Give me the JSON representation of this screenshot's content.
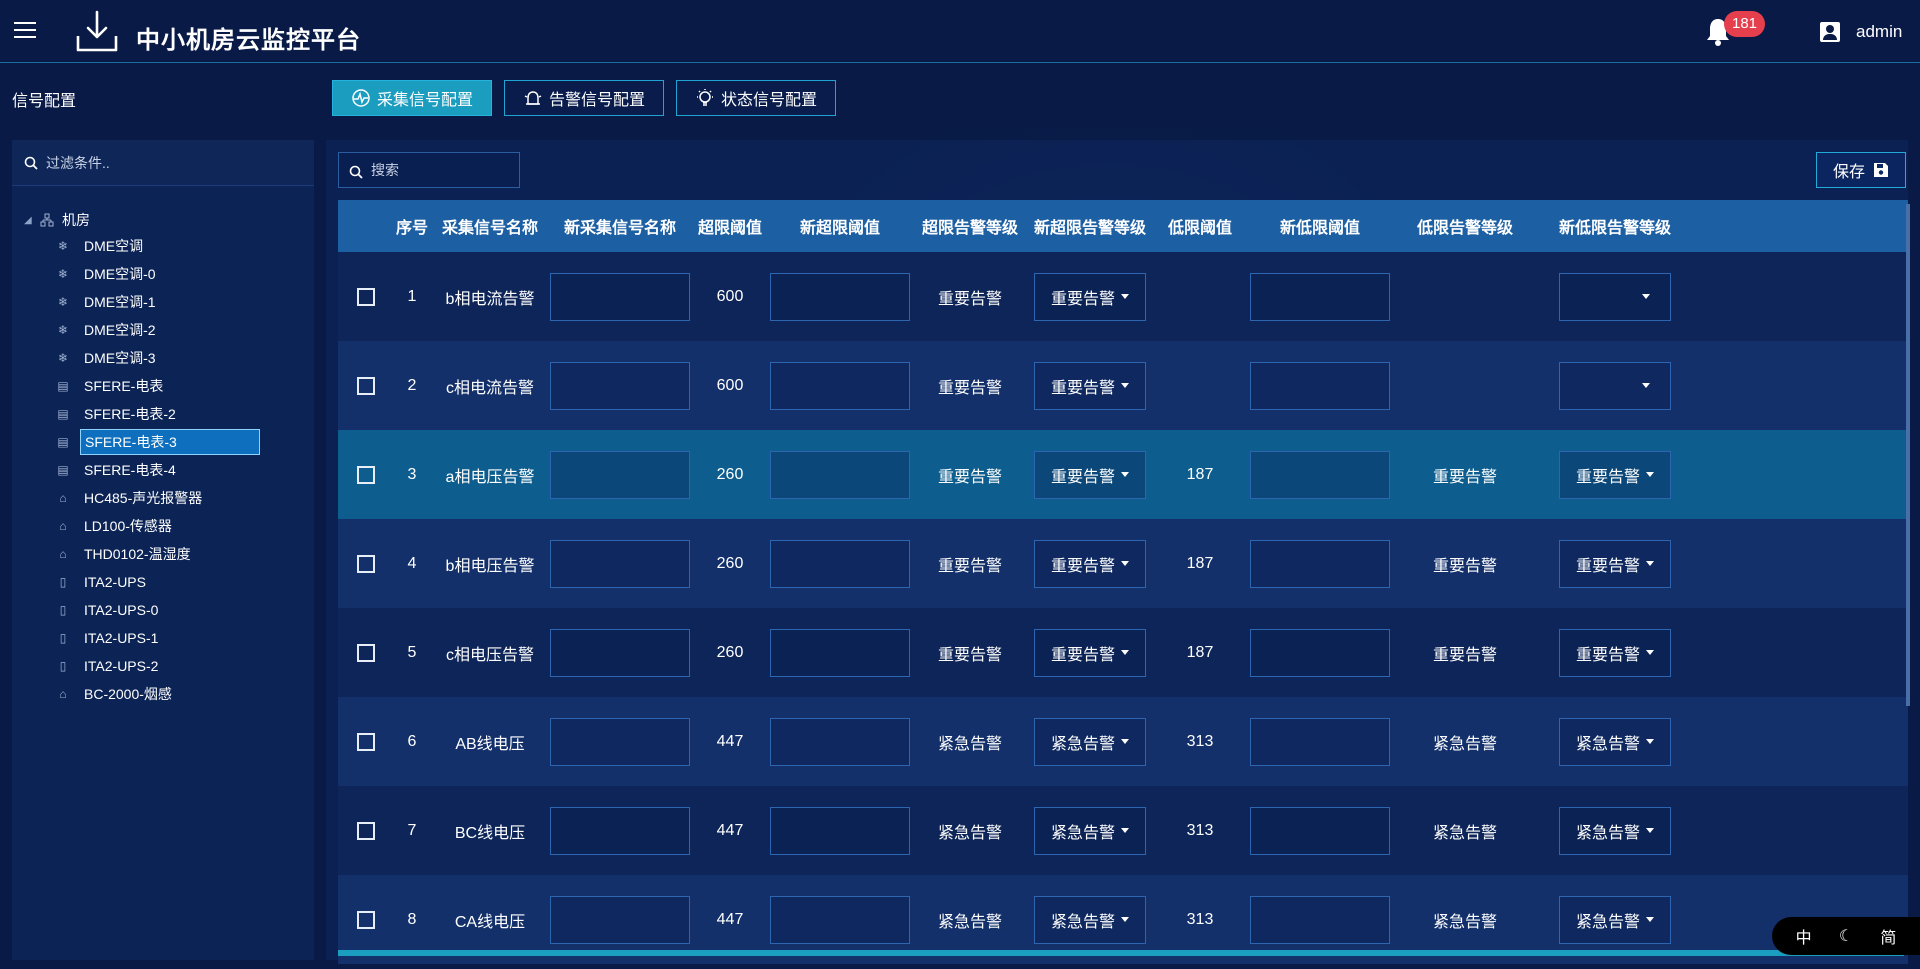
{
  "header": {
    "app_title": "中小机房云监控平台",
    "notification_count": "181",
    "username": "admin"
  },
  "subbar": {
    "page_title": "信号配置",
    "tabs": [
      {
        "label": "采集信号配置",
        "active": true
      },
      {
        "label": "告警信号配置",
        "active": false
      },
      {
        "label": "状态信号配置",
        "active": false
      }
    ]
  },
  "sidebar": {
    "filter_placeholder": "过滤条件..",
    "root_label": "机房",
    "items": [
      {
        "label": "DME空调",
        "icon": "snowflake-icon"
      },
      {
        "label": "DME空调-0",
        "icon": "snowflake-icon"
      },
      {
        "label": "DME空调-1",
        "icon": "snowflake-icon"
      },
      {
        "label": "DME空调-2",
        "icon": "snowflake-icon"
      },
      {
        "label": "DME空调-3",
        "icon": "snowflake-icon"
      },
      {
        "label": "SFERE-电表",
        "icon": "meter-icon"
      },
      {
        "label": "SFERE-电表-2",
        "icon": "meter-icon"
      },
      {
        "label": "SFERE-电表-3",
        "icon": "meter-icon",
        "selected": true
      },
      {
        "label": "SFERE-电表-4",
        "icon": "meter-icon"
      },
      {
        "label": "HC485-声光报警器",
        "icon": "home-icon"
      },
      {
        "label": "LD100-传感器",
        "icon": "home-icon"
      },
      {
        "label": "THD0102-温湿度",
        "icon": "home-icon"
      },
      {
        "label": "ITA2-UPS",
        "icon": "battery-icon"
      },
      {
        "label": "ITA2-UPS-0",
        "icon": "battery-icon"
      },
      {
        "label": "ITA2-UPS-1",
        "icon": "battery-icon"
      },
      {
        "label": "ITA2-UPS-2",
        "icon": "battery-icon"
      },
      {
        "label": "BC-2000-烟感",
        "icon": "home-icon"
      }
    ]
  },
  "main": {
    "search_placeholder": "搜索",
    "save_label": "保存",
    "columns": [
      "序号",
      "采集信号名称",
      "新采集信号名称",
      "超限阈值",
      "新超限阈值",
      "超限告警等级",
      "新超限告警等级",
      "低限阈值",
      "新低限阈值",
      "低限告警等级",
      "新低限告警等级"
    ],
    "rows": [
      {
        "seq": "1",
        "name": "b相电流告警",
        "over": "600",
        "over_level": "重要告警",
        "new_over_level": "重要告警",
        "low": "",
        "low_level": "",
        "new_low_level": ""
      },
      {
        "seq": "2",
        "name": "c相电流告警",
        "over": "600",
        "over_level": "重要告警",
        "new_over_level": "重要告警",
        "low": "",
        "low_level": "",
        "new_low_level": ""
      },
      {
        "seq": "3",
        "name": "a相电压告警",
        "over": "260",
        "over_level": "重要告警",
        "new_over_level": "重要告警",
        "low": "187",
        "low_level": "重要告警",
        "new_low_level": "重要告警"
      },
      {
        "seq": "4",
        "name": "b相电压告警",
        "over": "260",
        "over_level": "重要告警",
        "new_over_level": "重要告警",
        "low": "187",
        "low_level": "重要告警",
        "new_low_level": "重要告警"
      },
      {
        "seq": "5",
        "name": "c相电压告警",
        "over": "260",
        "over_level": "重要告警",
        "new_over_level": "重要告警",
        "low": "187",
        "low_level": "重要告警",
        "new_low_level": "重要告警"
      },
      {
        "seq": "6",
        "name": "AB线电压",
        "over": "447",
        "over_level": "紧急告警",
        "new_over_level": "紧急告警",
        "low": "313",
        "low_level": "紧急告警",
        "new_low_level": "紧急告警"
      },
      {
        "seq": "7",
        "name": "BC线电压",
        "over": "447",
        "over_level": "紧急告警",
        "new_over_level": "紧急告警",
        "low": "313",
        "low_level": "紧急告警",
        "new_low_level": "紧急告警"
      },
      {
        "seq": "8",
        "name": "CA线电压",
        "over": "447",
        "over_level": "紧急告警",
        "new_over_level": "紧急告警",
        "low": "313",
        "low_level": "紧急告警",
        "new_low_level": "紧急告警"
      }
    ]
  },
  "ime": {
    "mode": "中",
    "variant": "简"
  },
  "colors": {
    "accent": "#1b9dc0",
    "header_row": "#1d5fa3",
    "badge": "#e53e4d",
    "background": "#081a45"
  }
}
